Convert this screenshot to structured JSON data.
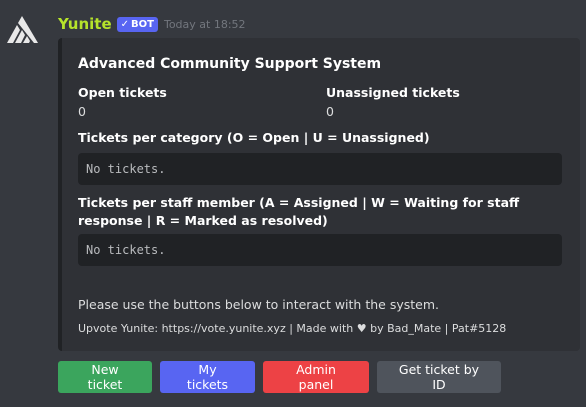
{
  "author": {
    "username": "Yunite",
    "badge": "BOT",
    "badge_icon": "check-icon",
    "timestamp": "Today at 18:52",
    "avatar_icon": "yunite-logo-icon"
  },
  "embed": {
    "title": "Advanced Community Support System",
    "fields": {
      "open_tickets": {
        "name": "Open tickets",
        "value": "0"
      },
      "unassigned_tickets": {
        "name": "Unassigned tickets",
        "value": "0"
      },
      "per_category": {
        "name": "Tickets per category (O = Open | U = Unassigned)",
        "value": "No tickets."
      },
      "per_staff": {
        "name": "Tickets per staff member (A = Assigned | W = Waiting for staff response | R = Marked as resolved)",
        "value": "No tickets."
      }
    },
    "description": "Please use the buttons below to interact with the system.",
    "footer": {
      "prefix": "Upvote Yunite: https://vote.yunite.xyz | Made with",
      "suffix": "by Bad_Mate | Pat#5128",
      "heart_icon": "heart-icon"
    }
  },
  "buttons": {
    "new_ticket": "New ticket",
    "my_tickets": "My tickets",
    "admin_panel": "Admin panel",
    "get_ticket_by_id": "Get ticket by ID"
  },
  "colors": {
    "background": "#36393f",
    "embed_background": "#2f3136",
    "username": "#b6e32b",
    "button_green": "#3ba55d",
    "button_blurple": "#5865f2",
    "button_red": "#ed4245",
    "button_grey": "#4f545c"
  }
}
